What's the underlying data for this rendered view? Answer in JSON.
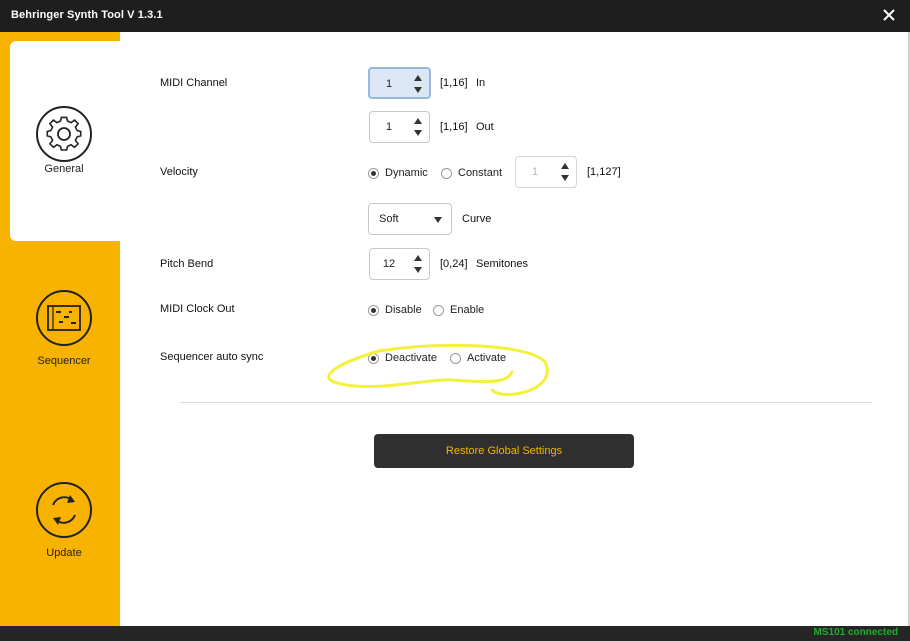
{
  "window": {
    "title": "Behringer Synth Tool V 1.3.1"
  },
  "sidebar": {
    "items": [
      {
        "label": "General",
        "icon": "gear-icon",
        "active": true
      },
      {
        "label": "Sequencer",
        "icon": "sequencer-icon",
        "active": false
      },
      {
        "label": "Update",
        "icon": "refresh-icon",
        "active": false
      }
    ]
  },
  "settings": {
    "midi_channel": {
      "label": "MIDI Channel",
      "in_value": "1",
      "in_range": "[1,16]",
      "in_suffix": "In",
      "out_value": "1",
      "out_range": "[1,16]",
      "out_suffix": "Out"
    },
    "velocity": {
      "label": "Velocity",
      "option_dynamic": "Dynamic",
      "option_constant": "Constant",
      "selected": "Dynamic",
      "constant_value": "1",
      "constant_range": "[1,127]",
      "curve_value": "Soft",
      "curve_label": "Curve"
    },
    "pitch_bend": {
      "label": "Pitch Bend",
      "value": "12",
      "range": "[0,24]",
      "unit": "Semitones"
    },
    "midi_clock_out": {
      "label": "MIDI Clock Out",
      "option_disable": "Disable",
      "option_enable": "Enable",
      "selected": "Disable"
    },
    "sequencer_auto_sync": {
      "label": "Sequencer auto sync",
      "option_deactivate": "Deactivate",
      "option_activate": "Activate",
      "selected": "Deactivate"
    }
  },
  "restore_button": {
    "label": "Restore Global Settings"
  },
  "status": {
    "text": "MS101 connected"
  },
  "colors": {
    "accent": "#f8b300",
    "titlebar": "#1e1e1e",
    "status_ok": "#1fae2b",
    "highlight": "#f2f23c"
  }
}
